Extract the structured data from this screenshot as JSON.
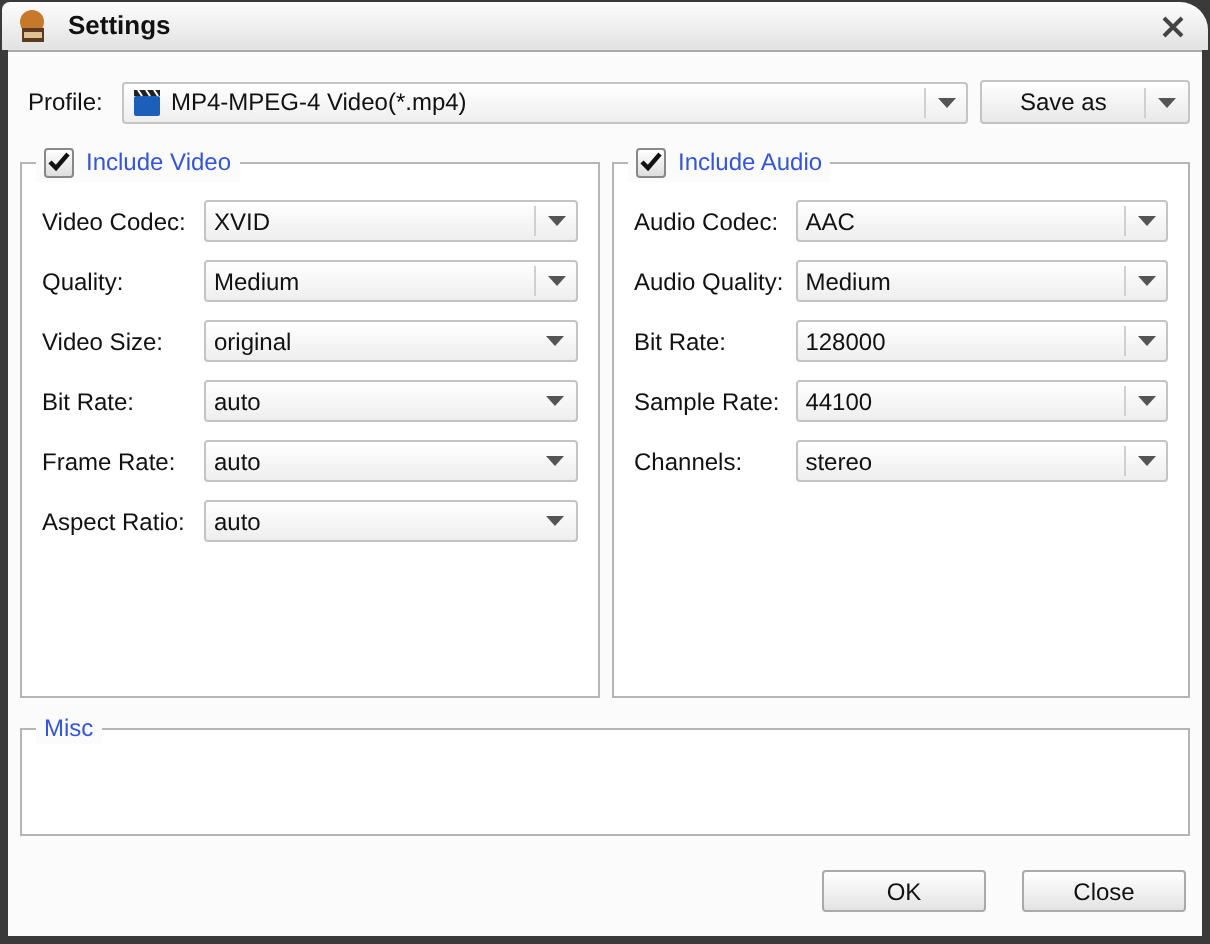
{
  "window": {
    "title": "Settings"
  },
  "profile": {
    "label": "Profile:",
    "value": "MP4-MPEG-4 Video(*.mp4)",
    "save_button": "Save as"
  },
  "video": {
    "title": "Include Video",
    "checked": true,
    "fields": [
      {
        "label": "Video Codec:",
        "value": "XVID",
        "separator": true
      },
      {
        "label": "Quality:",
        "value": "Medium",
        "separator": true
      },
      {
        "label": "Video Size:",
        "value": "original",
        "separator": false
      },
      {
        "label": "Bit Rate:",
        "value": "auto",
        "separator": false
      },
      {
        "label": "Frame Rate:",
        "value": "auto",
        "separator": false
      },
      {
        "label": "Aspect Ratio:",
        "value": "auto",
        "separator": false
      }
    ]
  },
  "audio": {
    "title": "Include Audio",
    "checked": true,
    "fields": [
      {
        "label": "Audio Codec:",
        "value": "AAC",
        "separator": true
      },
      {
        "label": "Audio Quality:",
        "value": "Medium",
        "separator": true
      },
      {
        "label": "Bit Rate:",
        "value": "128000",
        "separator": true
      },
      {
        "label": "Sample Rate:",
        "value": "44100",
        "separator": true
      },
      {
        "label": "Channels:",
        "value": "stereo",
        "separator": true
      }
    ]
  },
  "misc": {
    "title": "Misc"
  },
  "buttons": [
    "OK",
    "Close"
  ]
}
